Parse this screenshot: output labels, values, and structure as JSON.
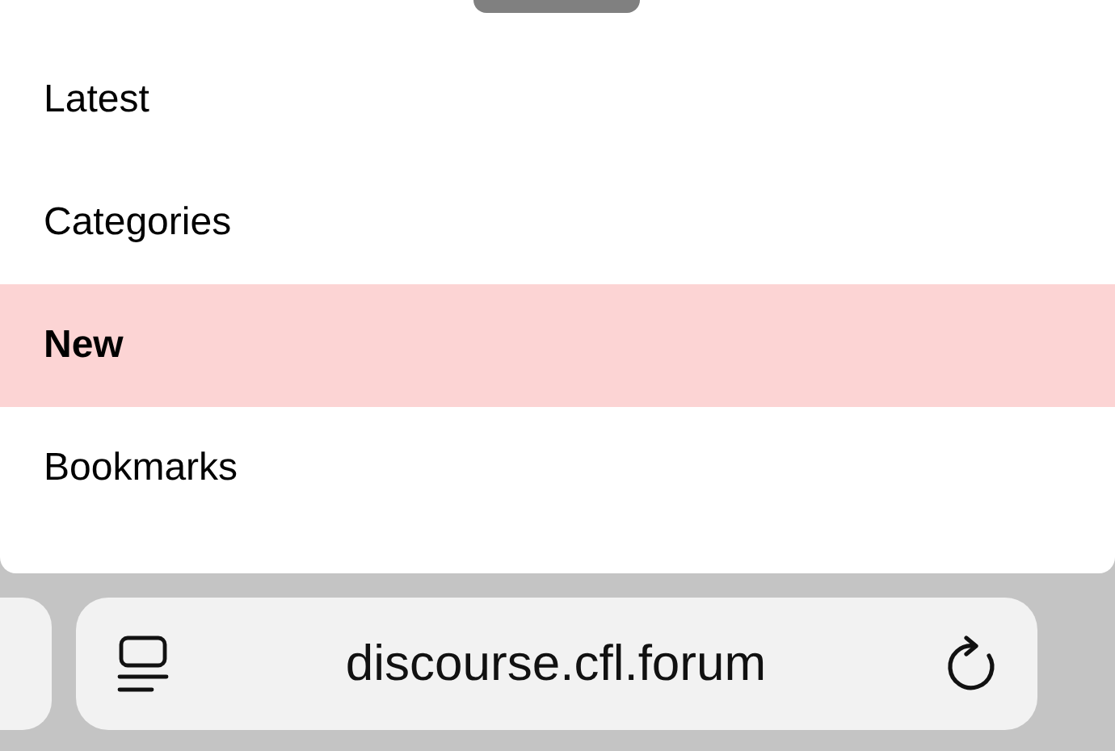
{
  "menu": {
    "items": [
      {
        "label": "Latest",
        "selected": false
      },
      {
        "label": "Categories",
        "selected": false
      },
      {
        "label": "New",
        "selected": true
      },
      {
        "label": "Bookmarks",
        "selected": false
      }
    ]
  },
  "address_bar": {
    "url": "discourse.cfl.forum"
  }
}
